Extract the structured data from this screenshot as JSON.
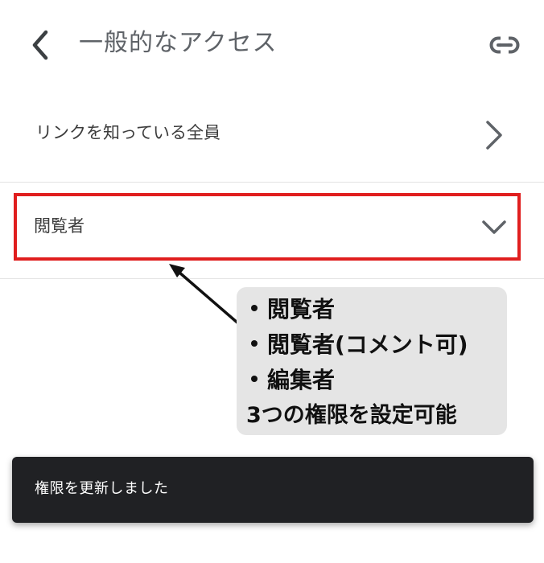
{
  "header": {
    "title": "一般的なアクセス",
    "back_icon": "chevron-left-icon",
    "link_icon": "link-icon"
  },
  "general_access": {
    "label": "リンクを知っている全員",
    "icon": "chevron-right-icon"
  },
  "role": {
    "selected": "閲覧者",
    "icon": "chevron-down-icon",
    "highlight_color": "#e01e1e"
  },
  "annotation": {
    "items": [
      "閲覧者",
      "閲覧者(コメント可)",
      "編集者"
    ],
    "note": "3つの権限を設定可能"
  },
  "snackbar": {
    "message": "権限を更新しました"
  },
  "colors": {
    "snackbar_bg": "#202124",
    "callout_bg": "#e5e5e5",
    "highlight": "#e01e1e"
  }
}
